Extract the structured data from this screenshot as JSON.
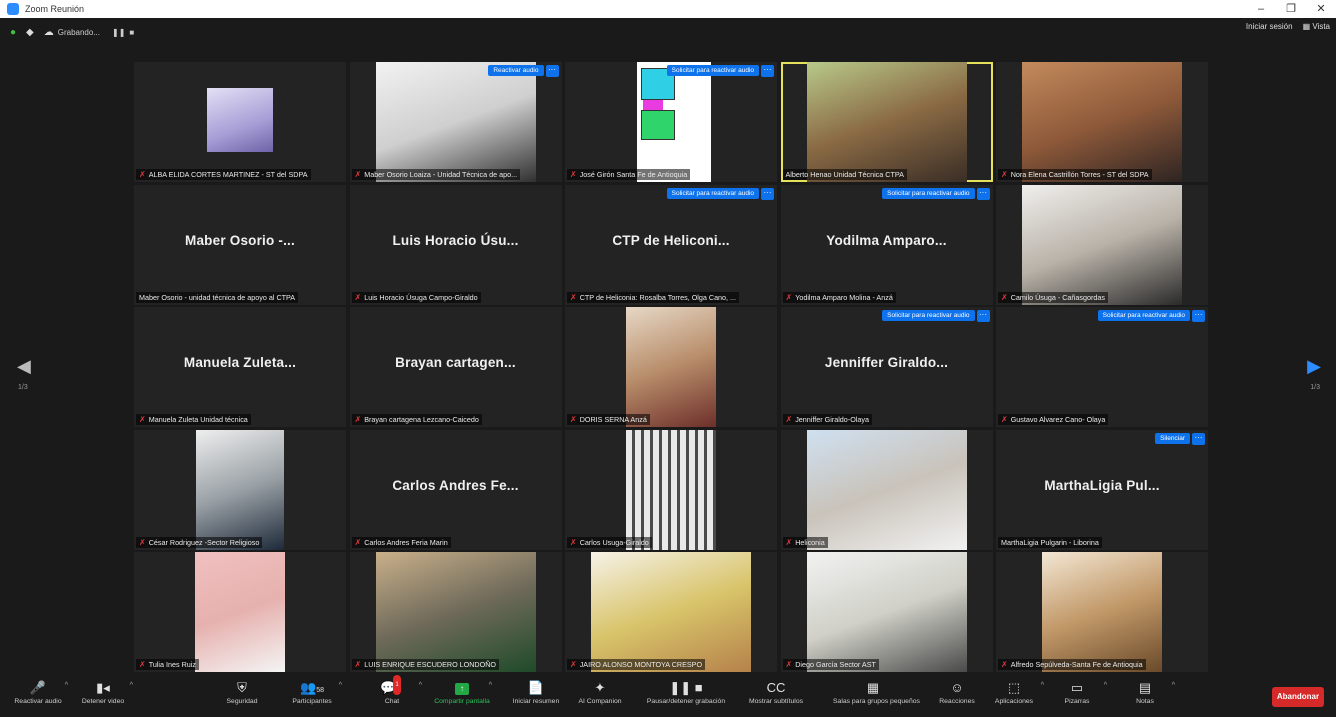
{
  "window": {
    "title": "Zoom Reunión",
    "minimize": "–",
    "restore": "❐",
    "close": "✕"
  },
  "topbar": {
    "recording_label": "Grabando...",
    "pause_icon": "❚❚",
    "stop_icon": "■",
    "signin_label": "Iniciar sesión",
    "view_label": "Vista"
  },
  "nav": {
    "left_page": "1/3",
    "right_page": "1/3"
  },
  "tiles": [
    {
      "row": 1,
      "col": 1,
      "kind": "avatar",
      "name": "ALBA ELIDA CORTES MARTINEZ - ST del SDPA",
      "muted": true
    },
    {
      "row": 1,
      "col": 2,
      "kind": "video",
      "photo": "p1",
      "name": "Maber Osorio Loaiza - Unidad Técnica de apo...",
      "muted": true,
      "button": "Reactivar audio"
    },
    {
      "row": 1,
      "col": 3,
      "kind": "slide",
      "name": "José Girón Santa Fe de Antioquia",
      "muted": true,
      "button": "Solicitar para reactivar audio"
    },
    {
      "row": 1,
      "col": 4,
      "kind": "video",
      "photo": "p3",
      "name": "Alberto Henao Unidad Técnica CTPA",
      "muted": false,
      "active": true
    },
    {
      "row": 1,
      "col": 5,
      "kind": "video",
      "photo": "p4",
      "name": "Nora Elena Castrillón Torres - ST del SDPA",
      "muted": true
    },
    {
      "row": 2,
      "col": 1,
      "kind": "name",
      "big": "Maber Osorio -...",
      "name": "Maber Osorio - unidad técnica de apoyo al CTPA",
      "muted": false
    },
    {
      "row": 2,
      "col": 2,
      "kind": "name",
      "big": "Luis Horacio Úsu...",
      "name": "Luis Horacio Úsuga Campo-Giraldo",
      "muted": true
    },
    {
      "row": 2,
      "col": 3,
      "kind": "name",
      "big": "CTP de Heliconi...",
      "name": "CTP de Heliconia: Rosalba Torres, Olga Cano, ...",
      "muted": true,
      "button": "Solicitar para reactivar audio"
    },
    {
      "row": 2,
      "col": 4,
      "kind": "name",
      "big": "Yodilma Amparo...",
      "name": "Yodilma Amparo Molina - Anzá",
      "muted": true,
      "button": "Solicitar para reactivar audio"
    },
    {
      "row": 2,
      "col": 5,
      "kind": "video",
      "photo": "p5",
      "name": "Camilo Úsuga - Cañasgordas",
      "muted": true
    },
    {
      "row": 3,
      "col": 1,
      "kind": "name",
      "big": "Manuela Zuleta...",
      "name": "Manuela Zuleta Unidad técnica",
      "muted": true
    },
    {
      "row": 3,
      "col": 2,
      "kind": "name",
      "big": "Brayan cartagen...",
      "name": "Brayan cartagena Lezcano-Caicedo",
      "muted": true
    },
    {
      "row": 3,
      "col": 3,
      "kind": "video",
      "photo": "p6",
      "name": "DORIS SERNA Anzá",
      "muted": true
    },
    {
      "row": 3,
      "col": 4,
      "kind": "name",
      "big": "Jenniffer Giraldo...",
      "name": "Jenniffer Giraldo-Olaya",
      "muted": true,
      "button": "Solicitar para reactivar audio"
    },
    {
      "row": 3,
      "col": 5,
      "kind": "name",
      "big": "",
      "name": "Gustavo Alvarez Cano- Olaya",
      "muted": true,
      "button": "Solicitar para reactivar audio"
    },
    {
      "row": 4,
      "col": 1,
      "kind": "video",
      "photo": "p7",
      "name": "César Rodriguez -Sector Religioso",
      "muted": true
    },
    {
      "row": 4,
      "col": 2,
      "kind": "name",
      "big": "Carlos Andres Fe...",
      "name": "Carlos Andres Feria Marin",
      "muted": true
    },
    {
      "row": 4,
      "col": 3,
      "kind": "video",
      "photo": "p8",
      "name": "Carlos Usuga-Giraldo",
      "muted": true
    },
    {
      "row": 4,
      "col": 4,
      "kind": "video",
      "photo": "p9",
      "name": "Heliconia",
      "muted": true
    },
    {
      "row": 4,
      "col": 5,
      "kind": "name",
      "big": "MarthaLigia Pul...",
      "name": "MarthaLigia Pulgarin - Liborina",
      "muted": false,
      "button": "Silenciar"
    },
    {
      "row": 5,
      "col": 1,
      "kind": "video",
      "photo": "p10",
      "name": "Tulia Ines Ruiz",
      "muted": true
    },
    {
      "row": 5,
      "col": 2,
      "kind": "video",
      "photo": "p11",
      "name": "LUIS ENRIQUE ESCUDERO LONDOÑO",
      "muted": true
    },
    {
      "row": 5,
      "col": 3,
      "kind": "video",
      "photo": "p12",
      "name": "JAIRO ALONSO MONTOYA CRESPO",
      "muted": true
    },
    {
      "row": 5,
      "col": 4,
      "kind": "video",
      "photo": "p13",
      "name": "Diego García Sector AST",
      "muted": true
    },
    {
      "row": 5,
      "col": 5,
      "kind": "video",
      "photo": "p14",
      "name": "Alfredo Sepúlveda-Santa Fe de Antioquia",
      "muted": true
    }
  ],
  "toolbar": {
    "items": [
      {
        "id": "unmute",
        "icon": "🎤",
        "label": "Reactivar audio",
        "caret": true
      },
      {
        "id": "video",
        "icon": "▮◂",
        "label": "Detener video",
        "caret": true
      },
      {
        "id": "security",
        "icon": "⛨",
        "label": "Seguridad",
        "caret": false
      },
      {
        "id": "participants",
        "icon": "👥",
        "label": "Participantes",
        "caret": true,
        "count": "58"
      },
      {
        "id": "chat",
        "icon": "💬",
        "label": "Chat",
        "caret": true,
        "badge": "1"
      },
      {
        "id": "share",
        "icon": "↑",
        "label": "Compartir pantalla",
        "caret": true
      },
      {
        "id": "summary",
        "icon": "📄",
        "label": "Iniciar resumen",
        "caret": false
      },
      {
        "id": "companion",
        "icon": "✦",
        "label": "AI Companion",
        "caret": false
      },
      {
        "id": "recording",
        "icon": "❚❚ ■",
        "label": "Pausar/detener grabación",
        "caret": false
      },
      {
        "id": "captions",
        "icon": "CC",
        "label": "Mostrar subtítulos",
        "caret": false
      },
      {
        "id": "breakout",
        "icon": "▦",
        "label": "Salas para grupos pequeños",
        "caret": false
      },
      {
        "id": "reactions",
        "icon": "☺",
        "label": "Reacciones",
        "caret": false
      },
      {
        "id": "apps",
        "icon": "⬚",
        "label": "Aplicaciones",
        "caret": true
      },
      {
        "id": "whiteboards",
        "icon": "▭",
        "label": "Pizarras",
        "caret": true
      },
      {
        "id": "notes",
        "icon": "▤",
        "label": "Notas",
        "caret": true
      }
    ],
    "leave_label": "Abandonar"
  }
}
